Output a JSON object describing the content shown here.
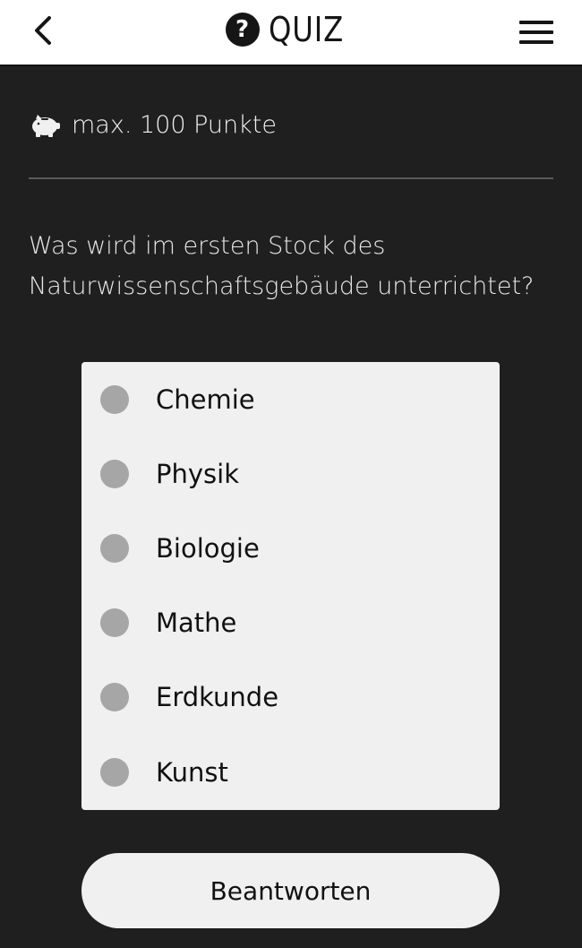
{
  "header": {
    "title": "QUIZ",
    "title_icon": "question-circle-icon",
    "back_icon": "chevron-left-icon",
    "menu_icon": "hamburger-menu-icon"
  },
  "points": {
    "icon": "piggy-bank-icon",
    "label": "max. 100 Punkte"
  },
  "question": {
    "text": "Was wird im ersten Stock des Naturwissenschaftsgebäude unterrichtet?"
  },
  "options": [
    {
      "label": "Chemie",
      "selected": false
    },
    {
      "label": "Physik",
      "selected": false
    },
    {
      "label": "Biologie",
      "selected": false
    },
    {
      "label": "Mathe",
      "selected": false
    },
    {
      "label": "Erdkunde",
      "selected": false
    },
    {
      "label": "Kunst",
      "selected": false
    }
  ],
  "submit": {
    "label": "Beantworten"
  },
  "colors": {
    "background": "#1f1f1f",
    "header_bg": "#ffffff",
    "card_bg": "#f0f0f0",
    "radio": "#a6a6a6",
    "text_light": "#e8e8e8",
    "text_dark": "#111111"
  }
}
